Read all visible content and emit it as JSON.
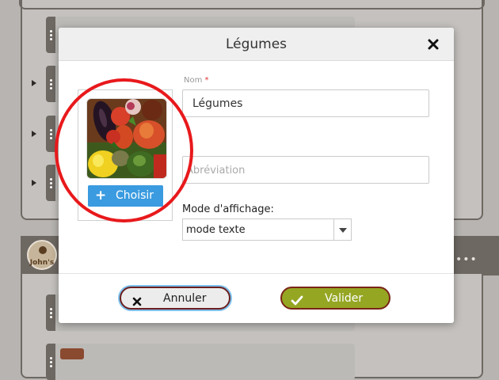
{
  "background": {
    "logo_text": "John's",
    "more_menu": "•••"
  },
  "modal": {
    "title": "Légumes",
    "close_icon": "close-icon",
    "image": {
      "choose_label": "Choisir",
      "choose_icon": "plus-icon"
    },
    "fields": {
      "name_label": "Nom",
      "name_required_mark": "*",
      "name_value": "Légumes",
      "abbreviation_placeholder": "Abréviation",
      "display_mode_label": "Mode d'affichage:",
      "display_mode_value": "mode texte"
    },
    "buttons": {
      "cancel_label": "Annuler",
      "cancel_icon": "close-icon",
      "validate_label": "Valider",
      "validate_icon": "check-icon"
    }
  },
  "colors": {
    "annotation_circle": "#e8191c",
    "choose_button": "#3a9be0",
    "validate_button": "#95a623"
  }
}
